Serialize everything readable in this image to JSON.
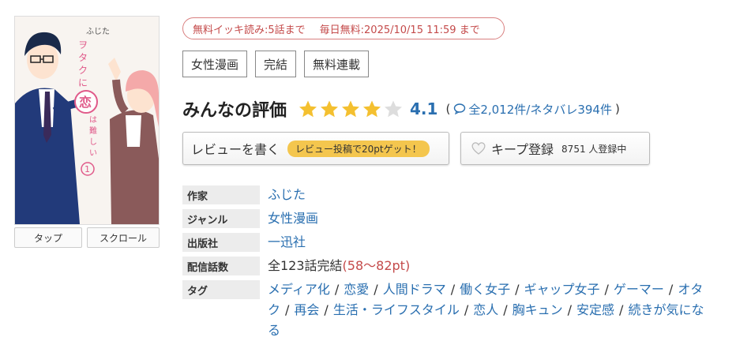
{
  "cover": {
    "title_glyphs": [
      "ヲ",
      "タ",
      "ク",
      "に",
      "恋",
      "は",
      "難",
      "し",
      "い"
    ],
    "volume": "1",
    "author_small": "ふじた"
  },
  "view_buttons": {
    "tap": "タップ",
    "scroll": "スクロール"
  },
  "free_banner": {
    "binge": "無料イッキ読み:5話まで",
    "daily": "毎日無料:2025/10/15 11:59 まで"
  },
  "tags": [
    "女性漫画",
    "完結",
    "無料連載"
  ],
  "rating": {
    "title": "みんなの評価",
    "stars": 4.1,
    "score": "4.1",
    "reviews": "全2,012件",
    "spoilers": "/ネタバレ394件",
    "paren_open": "(",
    "paren_close": ")"
  },
  "actions": {
    "review_label": "レビューを書く",
    "review_badge": "レビュー投稿で20ptゲット！",
    "keep_label": "キープ登録",
    "keep_count": "8751 人登録中"
  },
  "info": {
    "author_key": "作家",
    "author": "ふじた",
    "genre_key": "ジャンル",
    "genre": "女性漫画",
    "publisher_key": "出版社",
    "publisher": "一迅社",
    "episodes_key": "配信話数",
    "episodes": "全123話完結",
    "episodes_pt": "(58～82pt)",
    "tags_key": "タグ",
    "tag_list": [
      "メディア化",
      "恋愛",
      "人間ドラマ",
      "働く女子",
      "ギャップ女子",
      "ゲーマー",
      "オタク",
      "再会",
      "生活・ライフスタイル",
      "恋人",
      "胸キュン",
      "安定感",
      "続きが気になる"
    ]
  },
  "colors": {
    "link": "#2a6fb0",
    "star": "#f4c030",
    "star_empty": "#dddddd",
    "badge": "#f4c64e",
    "banner": "#c44a4a"
  }
}
